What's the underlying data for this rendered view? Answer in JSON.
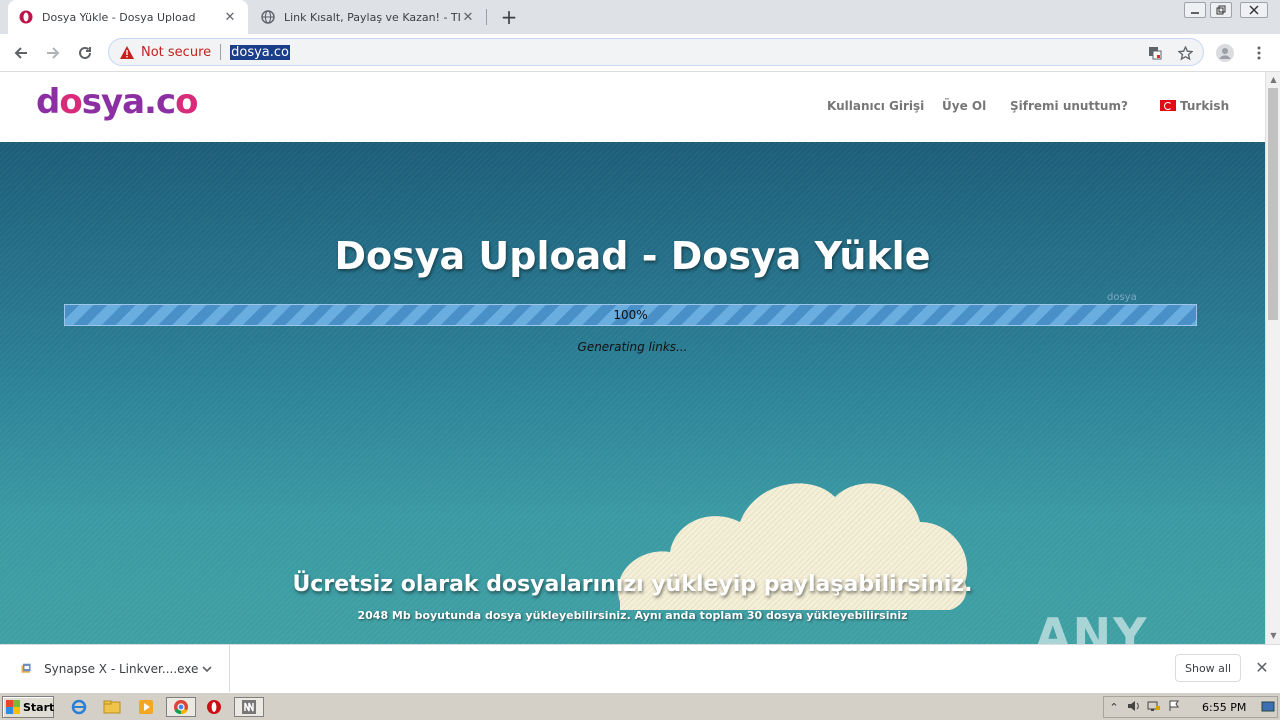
{
  "browser": {
    "tabs": [
      {
        "title": "Dosya Yükle - Dosya Upload",
        "active": true,
        "favicon": "opera-o-icon"
      },
      {
        "title": "Link Kısalt, Paylaş ve Kazan! - TIK.LA",
        "active": false,
        "favicon": "globe-icon"
      }
    ],
    "new_tab_symbol": "+",
    "close_symbol": "✕",
    "security_label": "Not secure",
    "url": "dosya.co"
  },
  "site": {
    "logo": {
      "part1": "d",
      "part2": "sya.c",
      "mark": "o"
    },
    "nav": {
      "login": "Kullanıcı Girişi",
      "register": "Üye Ol",
      "forgot": "Şifremi unuttum?",
      "language": "Turkish"
    },
    "hero": {
      "title": "Dosya Upload - Dosya Yükle",
      "progress_percent": 100,
      "progress_label": "100%",
      "status": "Generating links...",
      "small_label": "dosya",
      "tagline": "Ücretsiz olarak dosyalarınızı yükleyip paylaşabilirsiniz.",
      "subline": "2048 Mb boyutunda dosya yükleyebilirsiniz. Aynı anda toplam 30 dosya yükleyebilirsiniz"
    }
  },
  "download_bar": {
    "file_name": "Synapse X - Linkver....exe",
    "show_all": "Show all"
  },
  "watermark": "ANY RUN",
  "taskbar": {
    "start_label": "Start",
    "clock": "6:55 PM"
  },
  "colors": {
    "brand_purple": "#8b2fa3",
    "brand_pink": "#d82b7a",
    "hero_top": "#1d5d78",
    "hero_bottom": "#3fa0a3",
    "progress": "#4a90c8",
    "not_secure": "#c5221f"
  }
}
